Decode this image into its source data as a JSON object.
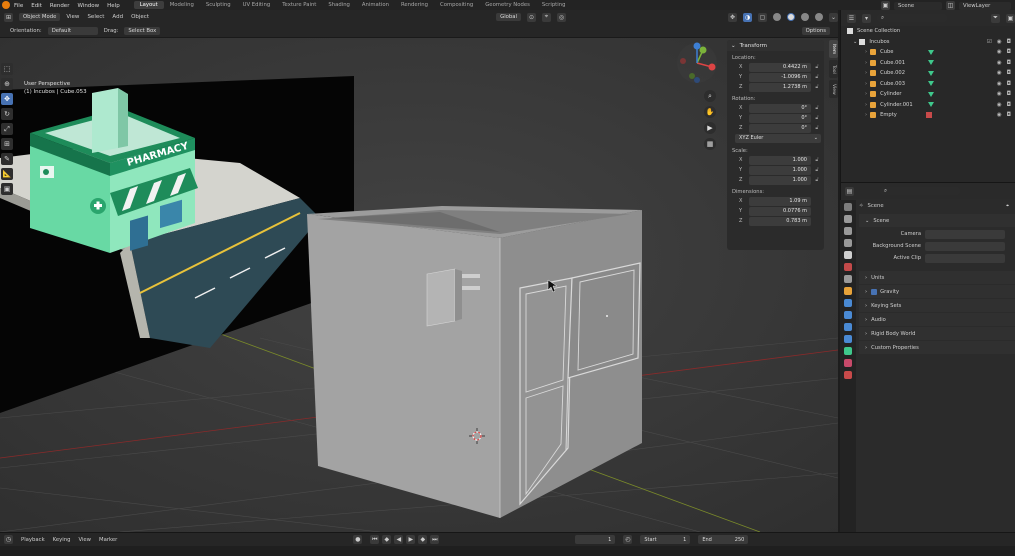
{
  "topbar": {
    "menus": [
      "File",
      "Edit",
      "Render",
      "Window",
      "Help"
    ],
    "workspaces": [
      "Layout",
      "Modeling",
      "Sculpting",
      "UV Editing",
      "Texture Paint",
      "Shading",
      "Animation",
      "Rendering",
      "Compositing",
      "Geometry Nodes",
      "Scripting"
    ],
    "active_workspace": "Layout",
    "scene": "Scene",
    "view_layer": "ViewLayer"
  },
  "viewport_header": {
    "mode": "Object Mode",
    "menus": [
      "View",
      "Select",
      "Add",
      "Object"
    ],
    "orientation": "Global"
  },
  "tool_settings": {
    "orientation_label": "Orientation:",
    "orientation_value": "Default",
    "drag_label": "Drag:",
    "drag_value": "Select Box",
    "options": "Options"
  },
  "viewport_info": {
    "line1": "User Perspective",
    "line2": "(1) Incubos | Cube.053"
  },
  "reference_image": {
    "sign": "PHARMACY"
  },
  "transform": {
    "title": "Transform",
    "location_label": "Location:",
    "location": [
      {
        "axis": "X",
        "value": "0.4422 m"
      },
      {
        "axis": "Y",
        "value": "-1.0096 m"
      },
      {
        "axis": "Z",
        "value": "1.2738 m"
      }
    ],
    "rotation_label": "Rotation:",
    "rotation": [
      {
        "axis": "X",
        "value": "0°"
      },
      {
        "axis": "Y",
        "value": "0°"
      },
      {
        "axis": "Z",
        "value": "0°"
      }
    ],
    "rotation_mode": "XYZ Euler",
    "scale_label": "Scale:",
    "scale": [
      {
        "axis": "X",
        "value": "1.000"
      },
      {
        "axis": "Y",
        "value": "1.000"
      },
      {
        "axis": "Z",
        "value": "1.000"
      }
    ],
    "dimensions_label": "Dimensions:",
    "dimensions": [
      {
        "axis": "X",
        "value": "1.09 m"
      },
      {
        "axis": "Y",
        "value": "0.0776 m"
      },
      {
        "axis": "Z",
        "value": "0.783 m"
      }
    ]
  },
  "side_tabs": [
    "Item",
    "Tool",
    "View"
  ],
  "outliner": {
    "root": "Scene Collection",
    "collection": "Incubos",
    "items": [
      {
        "name": "Cube",
        "icon_color": "#e8a33a"
      },
      {
        "name": "Cube.001",
        "icon_color": "#e8a33a"
      },
      {
        "name": "Cube.002",
        "icon_color": "#e8a33a"
      },
      {
        "name": "Cube.003",
        "icon_color": "#e8a33a"
      },
      {
        "name": "Cylinder",
        "icon_color": "#e8a33a"
      },
      {
        "name": "Cylinder.001",
        "icon_color": "#e8a33a"
      },
      {
        "name": "Empty",
        "icon_color": "#e8a33a"
      }
    ]
  },
  "properties": {
    "breadcrumb": "Scene",
    "scene_section": "Scene",
    "camera_label": "Camera",
    "background_scene_label": "Background Scene",
    "active_clip_label": "Active Clip",
    "sections": [
      "Units",
      "Gravity",
      "Keying Sets",
      "Audio",
      "Rigid Body World",
      "Custom Properties"
    ]
  },
  "timeline": {
    "menus": [
      "Playback",
      "Keying",
      "View",
      "Marker"
    ],
    "current_frame": "1",
    "start_label": "Start",
    "start": "1",
    "end_label": "End",
    "end": "250"
  },
  "colors": {
    "accent": "#4772b3",
    "blender_orange": "#e87d0d",
    "object_green": "#3fc88c"
  }
}
